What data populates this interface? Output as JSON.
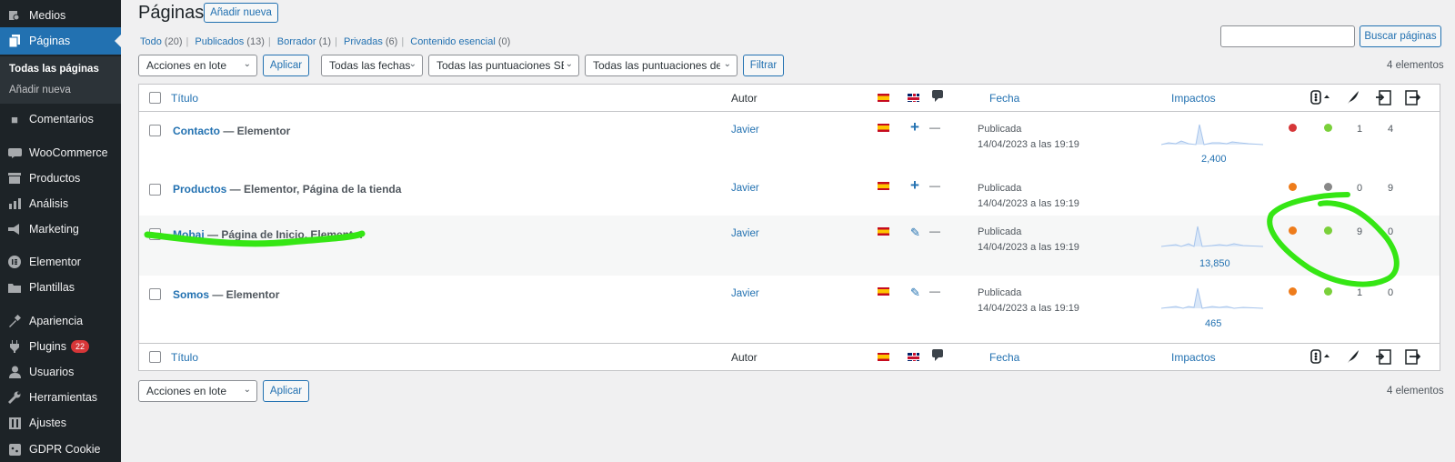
{
  "sidebar": {
    "items": [
      {
        "label": "Medios",
        "icon": "media-icon"
      },
      {
        "label": "Páginas",
        "icon": "pages-icon"
      },
      {
        "label": "Comentarios",
        "icon": "comments-icon"
      },
      {
        "label": "WooCommerce",
        "icon": "woocommerce-icon"
      },
      {
        "label": "Productos",
        "icon": "products-icon"
      },
      {
        "label": "Análisis",
        "icon": "analytics-icon"
      },
      {
        "label": "Marketing",
        "icon": "marketing-icon"
      },
      {
        "label": "Elementor",
        "icon": "elementor-icon"
      },
      {
        "label": "Plantillas",
        "icon": "templates-icon"
      },
      {
        "label": "Apariencia",
        "icon": "appearance-icon"
      },
      {
        "label": "Plugins",
        "icon": "plugins-icon",
        "badge": "22"
      },
      {
        "label": "Usuarios",
        "icon": "users-icon"
      },
      {
        "label": "Herramientas",
        "icon": "tools-icon"
      },
      {
        "label": "Ajustes",
        "icon": "settings-icon"
      },
      {
        "label": "GDPR Cookie",
        "icon": "cookie-icon"
      }
    ],
    "submenu": [
      "Todas las páginas",
      "Añadir nueva"
    ]
  },
  "header": {
    "title": "Páginas",
    "add_new": "Añadir nueva"
  },
  "filters": {
    "views": [
      {
        "label": "Todo",
        "count": "(20)"
      },
      {
        "label": "Publicados",
        "count": "(13)"
      },
      {
        "label": "Borrador",
        "count": "(1)"
      },
      {
        "label": "Privadas",
        "count": "(6)"
      },
      {
        "label": "Contenido esencial",
        "count": "(0)"
      }
    ],
    "bulk_action": "Acciones en lote",
    "apply": "Aplicar",
    "dates": "Todas las fechas",
    "seo_scores": "Todas las puntuaciones SEO",
    "readability_scores": "Todas las puntuaciones de",
    "filter": "Filtrar",
    "search_button": "Buscar páginas",
    "search_value": "",
    "items_count": "4 elementos"
  },
  "table": {
    "columns": {
      "title": "Título",
      "author": "Autor",
      "date": "Fecha",
      "impacts": "Impactos"
    },
    "rows": [
      {
        "title": "Contacto",
        "states": " — Elementor",
        "author": "Javier",
        "translation": "add",
        "status": "Publicada",
        "date": "14/04/2023 a las 19:19",
        "impacts": "2,400",
        "seo_color": "#d63638",
        "read_color": "#7ad03a",
        "links_in": "1",
        "links_out": "4"
      },
      {
        "title": "Productos",
        "states": " — Elementor, Página de la tienda",
        "author": "Javier",
        "translation": "add",
        "status": "Publicada",
        "date": "14/04/2023 a las 19:19",
        "impacts": "",
        "seo_color": "#ee7c1b",
        "read_color": "#888888",
        "links_in": "0",
        "links_out": "9"
      },
      {
        "title": "Mobai",
        "states": " — Página de Inicio, Elementor",
        "author": "Javier",
        "translation": "edit",
        "status": "Publicada",
        "date": "14/04/2023 a las 19:19",
        "impacts": "13,850",
        "seo_color": "#ee7c1b",
        "read_color": "#7ad03a",
        "links_in": "9",
        "links_out": "0"
      },
      {
        "title": "Somos",
        "states": " — Elementor",
        "author": "Javier",
        "translation": "edit",
        "status": "Publicada",
        "date": "14/04/2023 a las 19:19",
        "impacts": "465",
        "seo_color": "#ee7c1b",
        "read_color": "#7ad03a",
        "links_in": "1",
        "links_out": "0"
      }
    ]
  },
  "colors": {
    "accent": "#2271b1",
    "sidebar_bg": "#1d2327",
    "annotation": "#35e614"
  }
}
